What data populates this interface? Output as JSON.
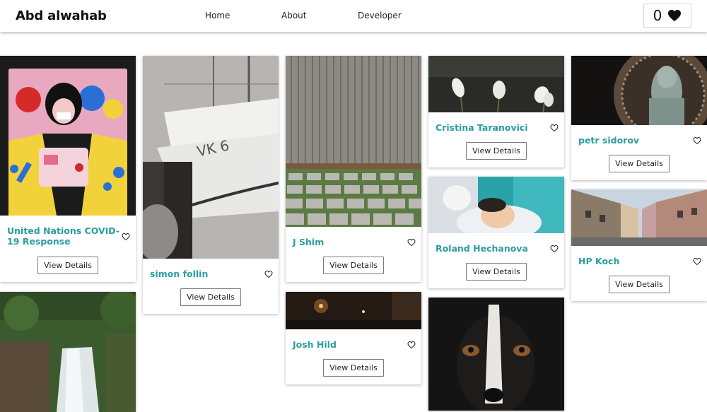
{
  "header": {
    "brand": "Abd alwahab",
    "nav": [
      {
        "label": "Home"
      },
      {
        "label": "About"
      },
      {
        "label": "Developer"
      }
    ],
    "favorites_count": "0",
    "favorites_icon": "heart-filled-icon"
  },
  "cards": [
    {
      "author": "United Nations COVID-19 Response",
      "button": "View Details",
      "favorite_icon": "heart-outline-icon"
    },
    {
      "author": "simon follin",
      "button": "View Details",
      "favorite_icon": "heart-outline-icon"
    },
    {
      "author": "J Shim",
      "button": "View Details",
      "favorite_icon": "heart-outline-icon"
    },
    {
      "author": "Cristina Taranovici",
      "button": "View Details",
      "favorite_icon": "heart-outline-icon"
    },
    {
      "author": "petr sidorov",
      "button": "View Details",
      "favorite_icon": "heart-outline-icon"
    },
    {
      "author": "Roland Hechanova",
      "button": "View Details",
      "favorite_icon": "heart-outline-icon"
    },
    {
      "author": "HP Koch",
      "button": "View Details",
      "favorite_icon": "heart-outline-icon"
    },
    {
      "author": "Josh Hild",
      "button": "View Details",
      "favorite_icon": "heart-outline-icon"
    }
  ],
  "colors": {
    "author_text": "#2a9d9f",
    "card_background": "#ffffff",
    "button_border": "#7a7a7a"
  }
}
